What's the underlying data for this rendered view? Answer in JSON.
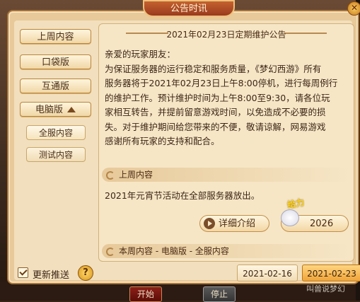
{
  "window": {
    "title": "公告时讯"
  },
  "nav": {
    "last_week": "上周内容",
    "pocket": "口袋版",
    "interop": "互通版",
    "pc": "电脑版",
    "all_servers": "全服内容",
    "test": "测试内容"
  },
  "announcement": {
    "title": "2021年02月23日定期维护公告",
    "greeting": "亲爱的玩家朋友：",
    "lines": [
      "为保证服务器的运行稳定和服务质量，《梦幻西游》所有",
      "服务器将于2021年02月23日上午8:00停机，进行每周例行",
      "的维护工作。预计维护时间为上午8:00至9:30，请各位玩",
      "家相互转告，并提前留意游戏时间，以免造成不必要的损",
      "失。对于维护期间给您带来的不便，敬请谅解，网易游戏",
      "感谢所有玩家的支持和配合。"
    ]
  },
  "sections": {
    "last_week_title": "上周内容",
    "last_week_text": "2021年元宵节活动在全部服务器放出。",
    "this_week_title": "本周内容 - 电脑版 - 全服内容"
  },
  "actions": {
    "detail_label": "详细介绍",
    "give_tag": "给力",
    "give_count": "2026"
  },
  "footer": {
    "auto_push_label": "更新推送",
    "help": "?",
    "date_prev": "2021-02-16",
    "date_curr": "2021-02-23"
  },
  "game": {
    "start": "开始",
    "stop": "停止",
    "watermark": "叫兽说梦幻"
  }
}
